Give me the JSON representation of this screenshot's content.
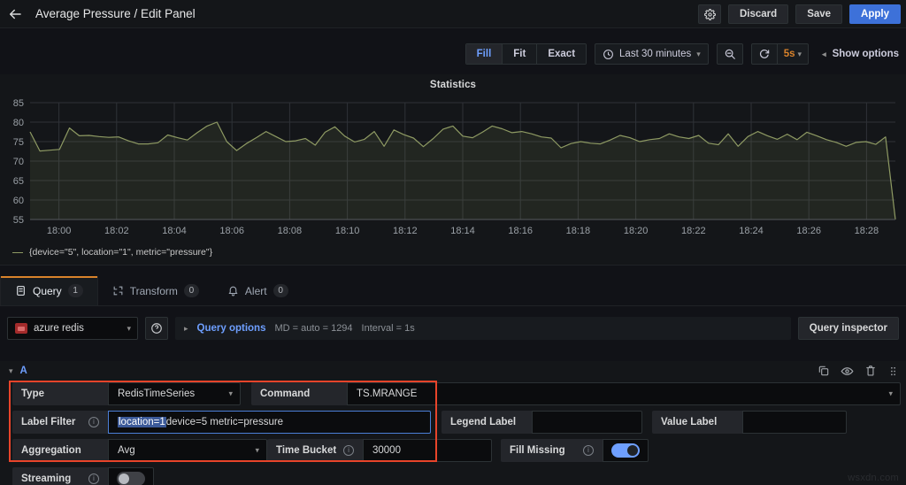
{
  "header": {
    "back_icon": "arrow-left-icon",
    "title": "Average Pressure / Edit Panel",
    "settings_icon": "gear-icon",
    "discard_label": "Discard",
    "save_label": "Save",
    "apply_label": "Apply",
    "accent_primary": "#3d71d9"
  },
  "options_bar": {
    "fit_modes": [
      {
        "label": "Fill",
        "active": true
      },
      {
        "label": "Fit",
        "active": false
      },
      {
        "label": "Exact",
        "active": false
      }
    ],
    "time_range": "Last 30 minutes",
    "time_icon": "clock-icon",
    "zoom_out_icon": "zoom-out-icon",
    "refresh_icon": "refresh-icon",
    "refresh_rate": "5s",
    "refresh_rate_color": "#d9822b",
    "show_options_label": "Show options",
    "show_options_icon": "chevron-left-icon"
  },
  "graph": {
    "title": "Statistics",
    "legend": "{device=\"5\", location=\"1\", metric=\"pressure\"}",
    "series_color": "#8e9a63"
  },
  "chart_data": {
    "type": "line",
    "title": "Statistics",
    "xlabel": "",
    "ylabel": "",
    "ylim": [
      55,
      85
    ],
    "yticks": [
      55,
      60,
      65,
      70,
      75,
      80,
      85
    ],
    "xticks": [
      "18:00",
      "18:02",
      "18:04",
      "18:06",
      "18:08",
      "18:10",
      "18:12",
      "18:14",
      "18:16",
      "18:18",
      "18:20",
      "18:22",
      "18:24",
      "18:26",
      "18:28"
    ],
    "grid": true,
    "legend_position": "bottom-left",
    "series": [
      {
        "name": "{device=\"5\", location=\"1\", metric=\"pressure\"}",
        "color": "#8e9a63",
        "values": [
          77.5,
          72.6,
          72.8,
          73.0,
          78.5,
          76.5,
          76.6,
          76.3,
          76.1,
          76.2,
          75.2,
          74.4,
          74.4,
          74.7,
          76.7,
          76.0,
          75.4,
          77.3,
          79.0,
          80.0,
          75.0,
          72.7,
          74.5,
          76.0,
          77.6,
          76.3,
          75.0,
          75.2,
          75.8,
          74.1,
          77.4,
          78.8,
          76.4,
          74.9,
          75.6,
          77.6,
          73.8,
          78.0,
          76.8,
          75.9,
          73.7,
          75.8,
          78.2,
          79.0,
          76.4,
          76.0,
          77.4,
          79.0,
          78.3,
          77.3,
          77.6,
          77.0,
          76.2,
          75.9,
          73.4,
          74.5,
          75.0,
          74.6,
          74.4,
          75.4,
          76.6,
          76.0,
          75.0,
          75.5,
          75.8,
          77.0,
          76.2,
          75.8,
          76.6,
          74.6,
          74.2,
          77.0,
          73.8,
          76.3,
          77.6,
          76.5,
          75.6,
          76.9,
          75.5,
          77.4,
          76.5,
          75.5,
          74.8,
          73.8,
          74.8,
          75.0,
          74.3,
          76.2,
          55.0
        ]
      }
    ]
  },
  "tabs": [
    {
      "label": "Query",
      "count": "1",
      "icon": "database-icon",
      "active": true
    },
    {
      "label": "Transform",
      "count": "0",
      "icon": "transform-icon",
      "active": false
    },
    {
      "label": "Alert",
      "count": "0",
      "icon": "bell-icon",
      "active": false
    }
  ],
  "datasource_row": {
    "datasource": "azure redis",
    "help_icon": "help-circle-icon",
    "expand_icon": "chevron-right-icon",
    "query_options_label": "Query options",
    "max_data_points": "MD = auto = 1294",
    "interval": "Interval = 1s",
    "query_inspector_label": "Query inspector"
  },
  "query_a": {
    "collapse_icon": "chevron-down-icon",
    "letter": "A",
    "actions": [
      {
        "icon": "duplicate-icon"
      },
      {
        "icon": "eye-icon"
      },
      {
        "icon": "trash-icon"
      },
      {
        "icon": "drag-handle-icon"
      }
    ],
    "highlight_color": "#e8442a",
    "fields": {
      "type_label": "Type",
      "type_value": "RedisTimeSeries",
      "command_label": "Command",
      "command_value": "TS.MRANGE",
      "label_filter_label": "Label Filter",
      "label_filter_selected": "location=1",
      "label_filter_rest": " device=5 metric=pressure",
      "legend_label_label": "Legend Label",
      "legend_label_value": "",
      "value_label_label": "Value Label",
      "value_label_value": "",
      "aggregation_label": "Aggregation",
      "aggregation_value": "Avg",
      "time_bucket_label": "Time Bucket",
      "time_bucket_value": "30000",
      "fill_missing_label": "Fill Missing",
      "fill_missing_on": true,
      "streaming_label": "Streaming",
      "streaming_on": false
    }
  },
  "watermark": "wsxdn.com"
}
